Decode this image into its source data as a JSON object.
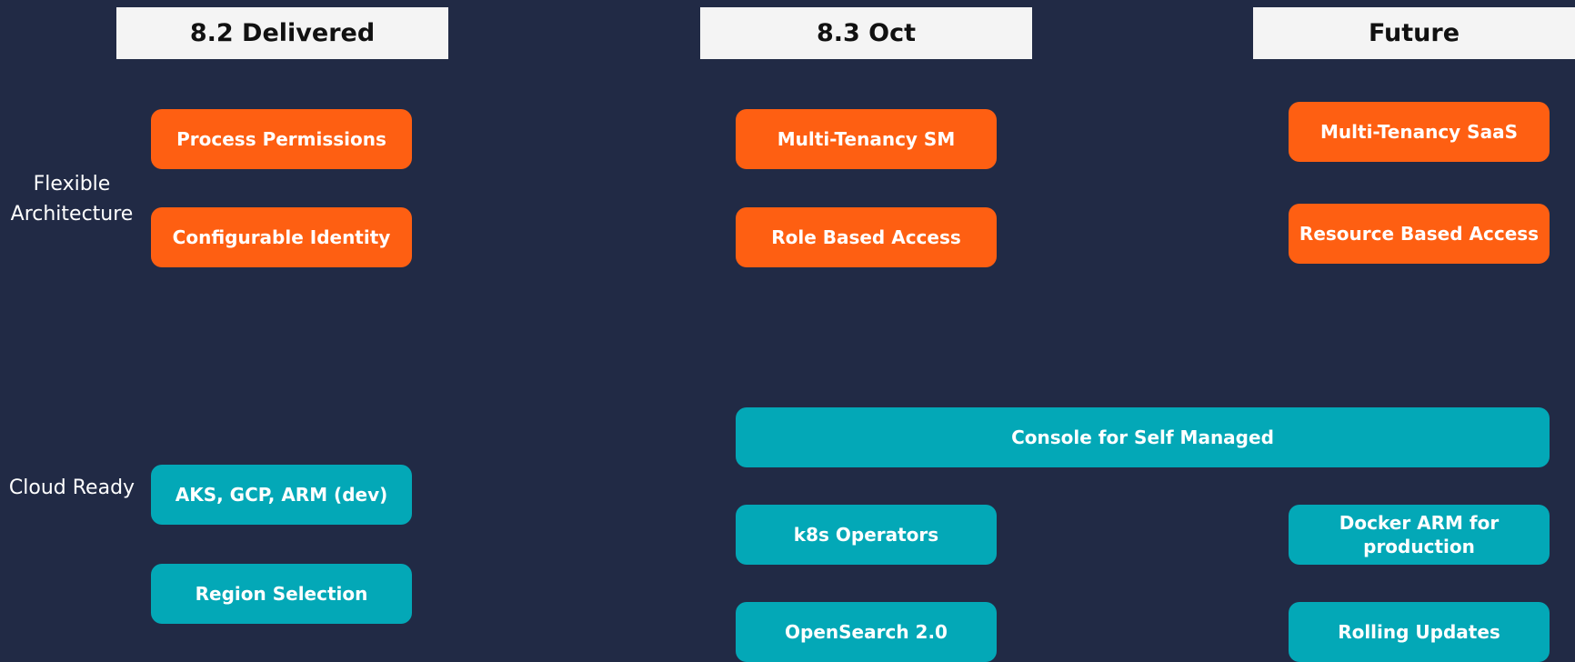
{
  "headers": {
    "col1": "8.2 Delivered",
    "col2": "8.3 Oct",
    "col3": "Future"
  },
  "row_labels": {
    "flexible_architecture": "Flexible Architecture",
    "cloud_ready": "Cloud Ready"
  },
  "items": {
    "process_permissions": "Process Permissions",
    "configurable_identity": "Configurable Identity",
    "multi_tenancy_sm": "Multi-Tenancy SM",
    "role_based_access": "Role Based Access",
    "multi_tenancy_saas": "Multi-Tenancy SaaS",
    "resource_based_access": "Resource Based Access",
    "console_self_managed": "Console for Self Managed",
    "aks_gcp_arm": "AKS, GCP, ARM (dev)",
    "region_selection": "Region Selection",
    "k8s_operators": "k8s Operators",
    "opensearch": "OpenSearch 2.0",
    "docker_arm": "Docker ARM for production",
    "rolling_updates": "Rolling Updates"
  },
  "colors": {
    "background": "#212a45",
    "orange": "#fe5f12",
    "teal": "#03a8b7",
    "header_bg": "#f4f4f4"
  }
}
